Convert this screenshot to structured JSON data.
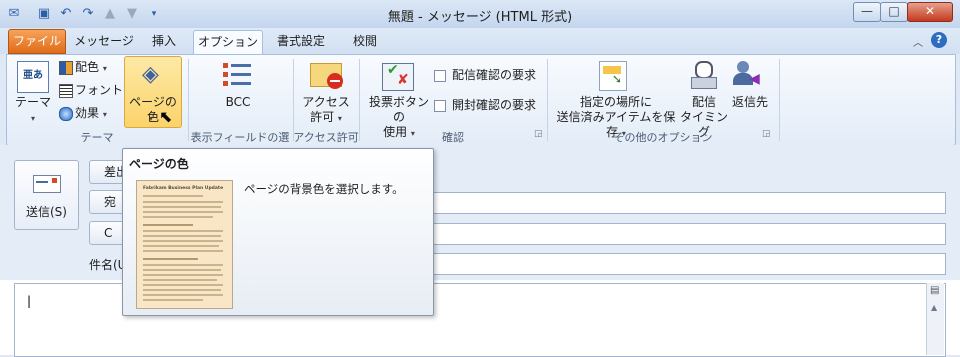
{
  "window": {
    "title": "無題 - メッセージ (HTML 形式)",
    "controls": {
      "minimize": "—",
      "maximize": "□",
      "close": "✕"
    }
  },
  "qat": [
    "save-icon",
    "undo-icon",
    "redo-icon",
    "up-icon",
    "down-icon",
    "customize-icon"
  ],
  "tabs": [
    "ファイル",
    "メッセージ",
    "挿入",
    "オプション",
    "書式設定",
    "校閲"
  ],
  "active_tab": "オプション",
  "ribbon": {
    "theme_group": {
      "label": "テーマ",
      "theme_btn": "テーマ",
      "colors": "配色",
      "fonts": "フォント",
      "effects": "効果",
      "page_color": "ページの色"
    },
    "fields_group": {
      "label": "表示フィールドの選択",
      "bcc": "BCC"
    },
    "access_group": {
      "label": "アクセス許可",
      "btn_line1": "アクセス",
      "btn_line2": "許可"
    },
    "tracking_group": {
      "label": "確認",
      "voting_line1": "投票ボタンの",
      "voting_line2": "使用",
      "delivery_receipt": "配信確認の要求",
      "read_receipt": "開封確認の要求"
    },
    "more_group": {
      "label": "その他のオプション",
      "save_sent_line1": "指定の場所に",
      "save_sent_line2": "送信済みアイテムを保存",
      "delay_line1": "配信",
      "delay_line2": "タイミング",
      "reply_to": "返信先"
    }
  },
  "compose": {
    "send": "送信(S)",
    "from_label": "差出",
    "to_label": "宛",
    "cc_label": "C",
    "subject_label": "件名(U"
  },
  "tooltip": {
    "title": "ページの色",
    "description": "ページの背景色を選択します。",
    "thumb_heading": "Fabrikam Business Plan Update"
  },
  "colors": {
    "file_tab": "#e06c17",
    "page_color_highlight": "#fbd36a",
    "close_button": "#c5391d",
    "thumbnail_bg": "#f8e6c6"
  }
}
